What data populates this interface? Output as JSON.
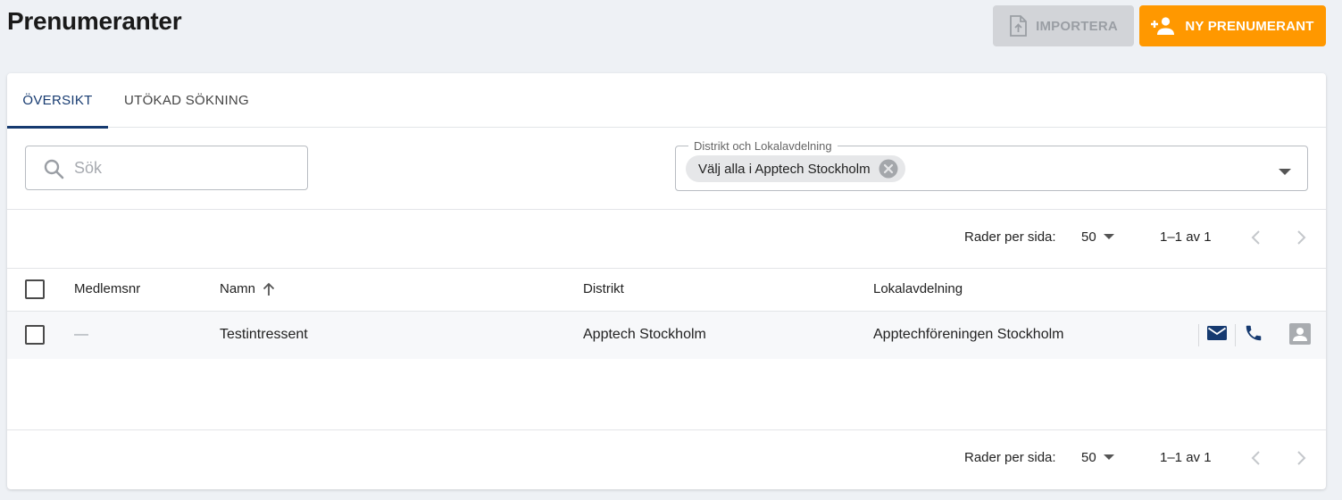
{
  "header": {
    "title": "Prenumeranter",
    "import_label": "IMPORTERA",
    "new_label": "NY PRENUMERANT"
  },
  "tabs": [
    {
      "label": "ÖVERSIKT",
      "active": true
    },
    {
      "label": "UTÖKAD SÖKNING",
      "active": false
    }
  ],
  "filters": {
    "search_placeholder": "Sök",
    "district_label": "Distrikt och Lokalavdelning",
    "district_chip": "Välj alla i Apptech Stockholm"
  },
  "pagination": {
    "rows_label": "Rader per sida:",
    "rows_value": "50",
    "range": "1–1 av 1"
  },
  "table": {
    "columns": [
      "Medlemsnr",
      "Namn",
      "Distrikt",
      "Lokalavdelning"
    ],
    "sort_column": "Namn",
    "rows": [
      {
        "member_no": "—",
        "name": "Testintressent",
        "district": "Apptech Stockholm",
        "local": "Apptechföreningen Stockholm"
      }
    ]
  },
  "colors": {
    "accent": "#ff9800",
    "primary": "#163a70",
    "disabled": "#d2d4d8"
  },
  "icons": {
    "import": "upload-file-icon",
    "new": "person-add-icon",
    "search": "search-icon",
    "email": "email-icon",
    "phone": "phone-icon",
    "profile": "contact-card-icon"
  }
}
